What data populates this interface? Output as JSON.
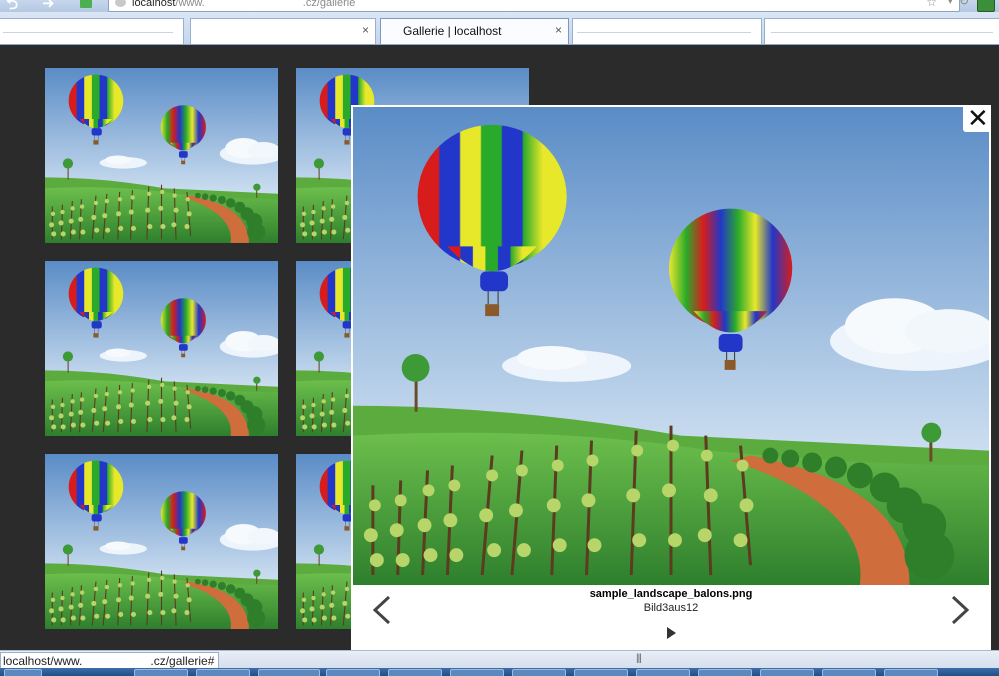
{
  "browser": {
    "url_host": "localhost",
    "url_path_start": "/www.",
    "url_path_end": ".cz/gallerie",
    "tabs": [
      {
        "title": "",
        "close": ""
      },
      {
        "title": "",
        "close": "×"
      },
      {
        "title": "Gallerie | localhost",
        "close": "×"
      },
      {
        "title": "",
        "close": ""
      },
      {
        "title": "",
        "close": ""
      }
    ],
    "icons": [
      "back-icon",
      "forward-icon",
      "site-favicon",
      "star-icon",
      "dropdown-icon",
      "reload-icon",
      "addon-icon"
    ]
  },
  "gallery": {
    "thumbnail_count_visible": 6
  },
  "lightbox": {
    "filename": "sample_landscape_balons.png",
    "counter": "Bild3aus12",
    "close_symbol": "✕"
  },
  "status": {
    "url_start": "localhost/www.",
    "url_end": ".cz/gallerie#",
    "grip": "|||"
  },
  "colors": {
    "page_background": "#2b2b2b",
    "sky_top": "#5f90c8",
    "grass": "#3f9a3a",
    "path": "#c96a3a"
  }
}
